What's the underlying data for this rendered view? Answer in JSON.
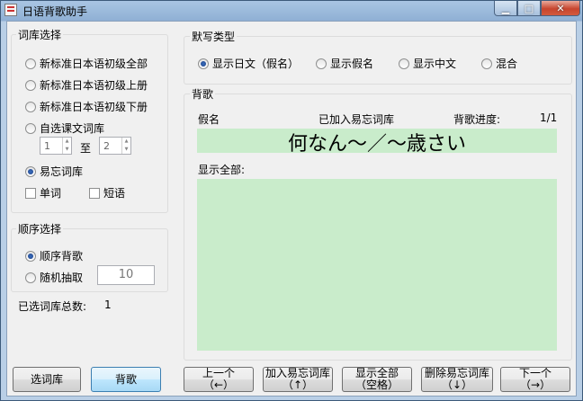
{
  "window": {
    "title": "日语背歌助手"
  },
  "library": {
    "label": "词库选择",
    "options": [
      "新标准日本语初级全部",
      "新标准日本语初级上册",
      "新标准日本语初级下册",
      "自选课文词库",
      "易忘词库"
    ],
    "selected_index": 4,
    "range_from": "1",
    "range_to_label": "至",
    "range_to": "2",
    "checks": [
      "单词",
      "短语"
    ]
  },
  "order": {
    "label": "顺序选择",
    "options": [
      "顺序背歌",
      "随机抽取"
    ],
    "selected_index": 0,
    "random_count": "10"
  },
  "summary": {
    "label": "已选词库总数:",
    "value": "1"
  },
  "dictation": {
    "label": "默写类型",
    "options": [
      "显示日文（假名）",
      "显示假名",
      "显示中文",
      "混合"
    ],
    "selected_index": 0
  },
  "recite": {
    "label": "背歌",
    "kana_label": "假名",
    "added_label": "已加入易忘词库",
    "progress_label": "背歌进度:",
    "progress_value": "1/1",
    "word": "何なん～／～歳さい",
    "show_all_label": "显示全部:"
  },
  "buttons": {
    "select_library": "选词库",
    "recite": "背歌",
    "prev": [
      "上一个",
      "（←）"
    ],
    "add_forget": [
      "加入易忘词库",
      "（↑）"
    ],
    "show_all": [
      "显示全部",
      "（空格）"
    ],
    "delete_forget": [
      "删除易忘词库",
      "（↓）"
    ],
    "next": [
      "下一个",
      "（→）"
    ]
  }
}
